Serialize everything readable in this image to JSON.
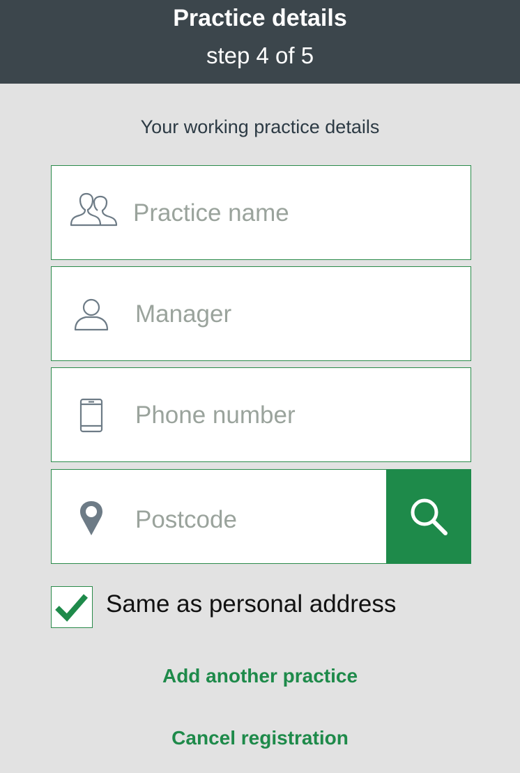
{
  "header": {
    "title": "Practice details",
    "step": "step 4 of 5"
  },
  "subtitle": "Your working practice details",
  "fields": {
    "practice_name": {
      "placeholder": "Practice name",
      "icon": "users-icon"
    },
    "manager": {
      "placeholder": "Manager",
      "icon": "user-icon"
    },
    "phone": {
      "placeholder": "Phone number",
      "icon": "mobile-phone-icon"
    },
    "postcode": {
      "placeholder": "Postcode",
      "icon": "map-pin-icon",
      "action_icon": "search-icon"
    }
  },
  "same_as_personal": {
    "label": "Same as personal address",
    "checked": true
  },
  "links": {
    "add_another": "Add another practice",
    "cancel": "Cancel registration"
  },
  "colors": {
    "header_bg": "#3c464c",
    "page_bg": "#e2e2e2",
    "accent": "#1e8a4a",
    "placeholder": "#9aa39c",
    "icon": "#6d7b86"
  }
}
